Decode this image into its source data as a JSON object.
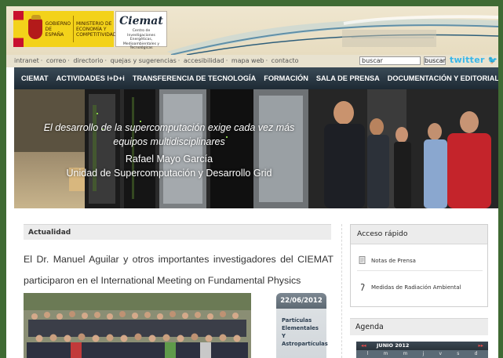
{
  "header": {
    "gov_text": "GOBIERNO DE ESPAÑA",
    "ministry_text": "MINISTERIO DE ECONOMÍA Y COMPETITIVIDAD",
    "logo_text": "Ciemat",
    "logo_subtitle": "Centro de Investigaciones Energéticas, Medioambientales y Tecnológicas"
  },
  "utility": {
    "links": [
      "intranet",
      "correo",
      "directorio",
      "quejas y sugerencias",
      "accesibilidad",
      "mapa web",
      "contacto"
    ],
    "separator": "·",
    "search_placeholder": "buscar",
    "search_button": "buscar",
    "twitter_label": "twitter"
  },
  "nav": {
    "items": [
      "CIEMAT",
      "ACTIVIDADES I+D+i",
      "TRANSFERENCIA DE TECNOLOGÍA",
      "FORMACIÓN",
      "SALA DE PRENSA",
      "DOCUMENTACIÓN Y EDITORIAL"
    ]
  },
  "hero": {
    "slogan_line1": "El desarrollo de la supercomputación exige cada vez más",
    "slogan_line2": "equipos multidisciplinares",
    "person": "Rafael Mayo García",
    "unit": "Unidad de Supercomputación y Desarrollo Grid"
  },
  "news": {
    "section_title": "Actualidad",
    "headline": "El Dr. Manuel Aguilar y otros importantes investigadores del CIEMAT participaron en el International Meeting on Fundamental Physics",
    "date": "22/06/2012",
    "tags": [
      "Partículas",
      "Elementales Y",
      "Astropartículas"
    ]
  },
  "sidebar": {
    "quick_title": "Acceso rápido",
    "quick_items": [
      "Notas de Prensa",
      "Medidas de Radiación Ambiental"
    ],
    "agenda_title": "Agenda",
    "calendar_month": "JUNIO 2012",
    "calendar_prev": "◂◂",
    "calendar_next": "▸▸",
    "calendar_days": [
      "l",
      "m",
      "m",
      "j",
      "v",
      "s",
      "d"
    ]
  },
  "colors": {
    "nav_bg": "#1e2a34",
    "frame_green": "#3f6a33",
    "twitter": "#38b7ea",
    "date_badge": "#5d6872"
  }
}
